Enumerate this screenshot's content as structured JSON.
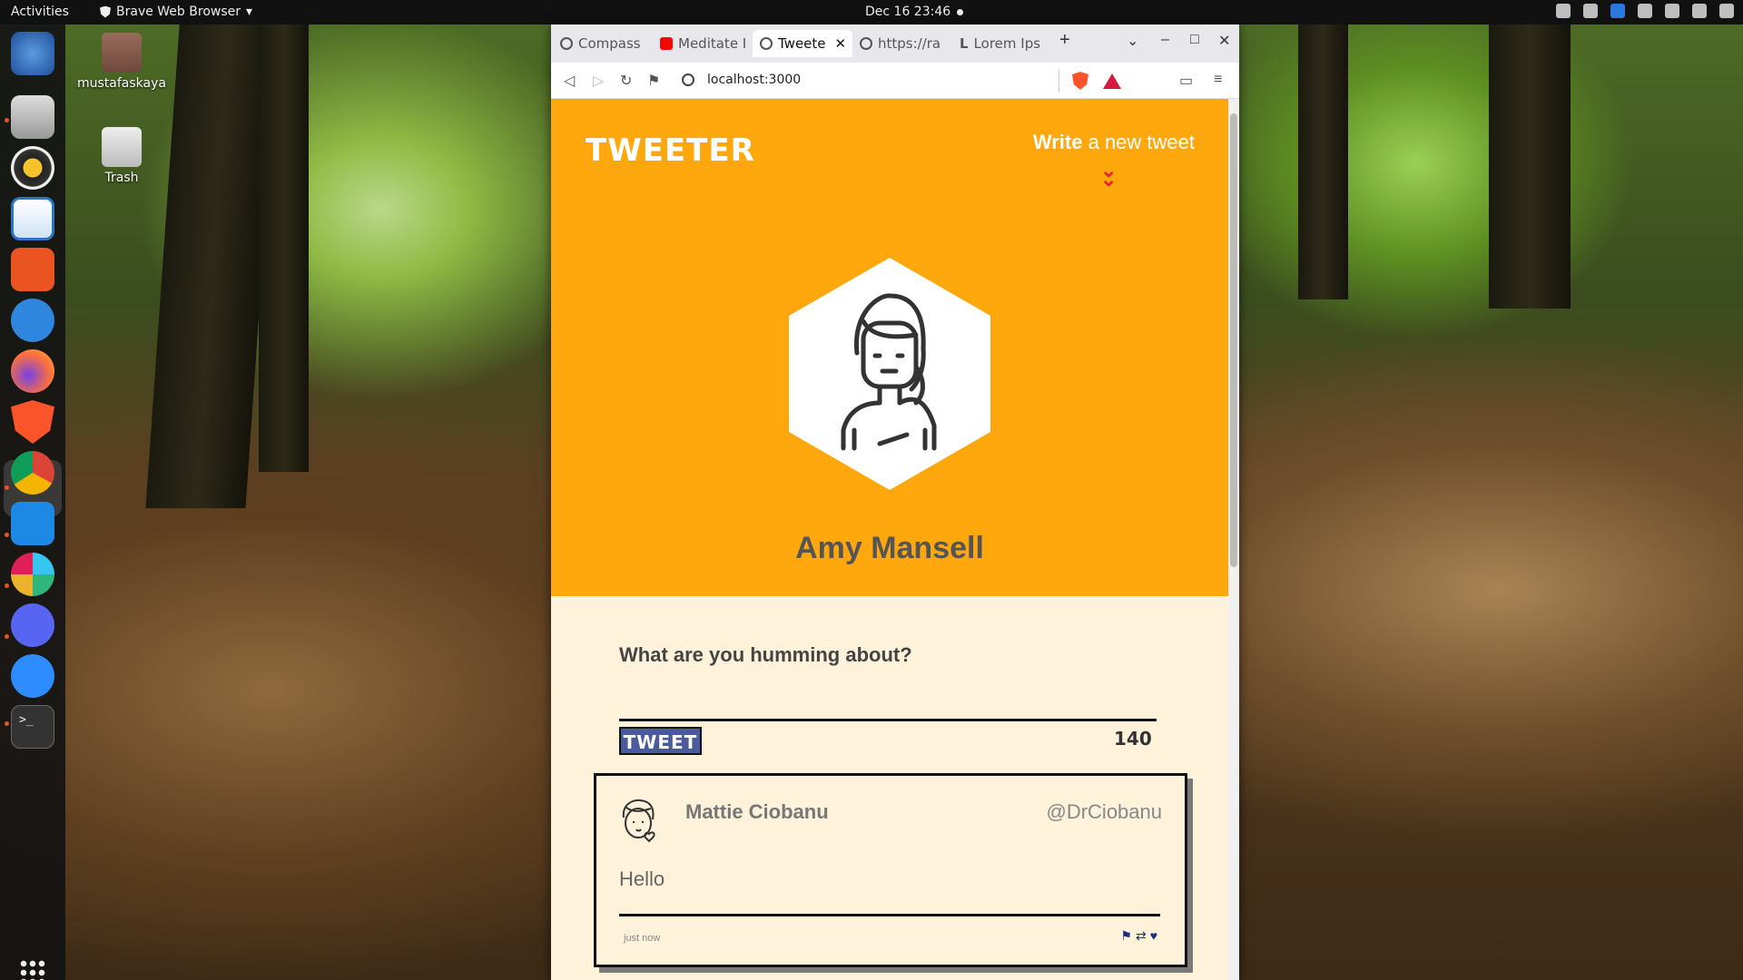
{
  "topbar": {
    "activities": "Activities",
    "app_name": "Brave Web Browser",
    "clock": "Dec 16  23:46"
  },
  "desktop": {
    "home_label": "mustafaskaya",
    "trash_label": "Trash"
  },
  "dock": {
    "items": [
      "thunderbird-icon",
      "files-icon",
      "rhythmbox-icon",
      "writer-icon",
      "software-icon",
      "help-icon",
      "firefox-icon",
      "brave-icon",
      "chrome-icon",
      "vscode-icon",
      "slack-icon",
      "discord-icon",
      "zoom-icon",
      "terminal-icon"
    ]
  },
  "browser": {
    "tabs": [
      {
        "label": "Compass",
        "icon": "compass-icon"
      },
      {
        "label": "Meditate I",
        "icon": "youtube-icon"
      },
      {
        "label": "Tweete",
        "icon": "globe-icon",
        "active": true
      },
      {
        "label": "https://ra",
        "icon": "globe-icon"
      },
      {
        "label": "Lorem Ips",
        "icon": "lorem-icon"
      }
    ],
    "url": "localhost:3000"
  },
  "page": {
    "logo": "TWEETER",
    "compose_bold": "Write",
    "compose_rest": " a new tweet",
    "user_name": "Amy Mansell",
    "prompt": "What are you humming about?",
    "tweet_button": "TWEET",
    "counter": "140",
    "tweets": [
      {
        "name": "Mattie Ciobanu",
        "handle": "@DrCiobanu",
        "body": "Hello",
        "time": "just now"
      }
    ]
  },
  "colors": {
    "hero_bg": "#ffa80e",
    "page_bg": "#fff2da",
    "button_bg": "#4a5a9c",
    "accent_red": "#e8222a"
  }
}
